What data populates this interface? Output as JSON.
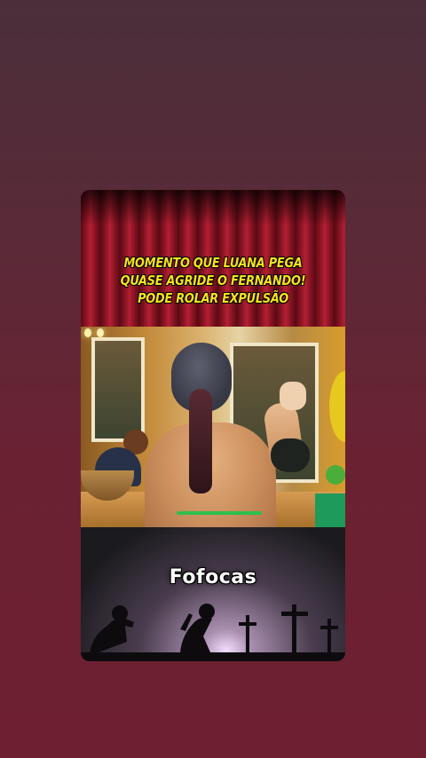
{
  "story": {
    "headline_lines": [
      "MOMENTO QUE LUANA PEGA",
      "QUASE AGRIDE O FERNANDO!",
      "PODE ROLAR EXPULSÃO"
    ],
    "footer_title": "Fofocas"
  },
  "colors": {
    "headline": "#f6e21c",
    "curtain": "#b41f33",
    "background": "#6a2233"
  },
  "icons": [
    "cross-icon",
    "praying-silhouette-icon"
  ]
}
